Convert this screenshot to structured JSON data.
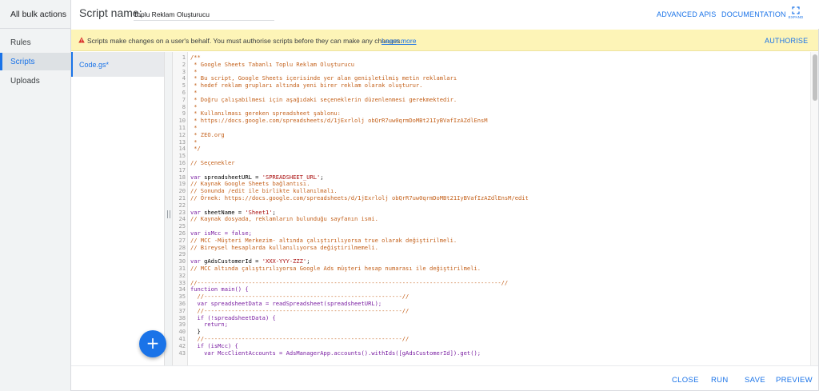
{
  "sidebar": {
    "all_bulk_actions": "All bulk actions",
    "items": [
      {
        "label": "Rules"
      },
      {
        "label": "Scripts"
      },
      {
        "label": "Uploads"
      }
    ]
  },
  "header": {
    "script_name_label": "Script name:",
    "script_name_value": "Toplu Reklam Oluşturucu",
    "advanced_apis": "ADVANCED APIS",
    "documentation": "DOCUMENTATION",
    "expand": "EXPAND"
  },
  "banner": {
    "text": "Scripts make changes on a user's behalf. You must authorise scripts before they can make any changes.",
    "learn_more": "Learn more",
    "authorise": "AUTHORISE"
  },
  "files": [
    {
      "label": "Code.gs*"
    }
  ],
  "editor": {
    "lines": [
      {
        "n": "1",
        "t": "/**"
      },
      {
        "n": "2",
        "t": " * Google Sheets Tabanlı Toplu Reklam Oluşturucu"
      },
      {
        "n": "3",
        "t": " *"
      },
      {
        "n": "4",
        "t": " * Bu script, Google Sheets içerisinde yer alan genişletilmiş metin reklamları"
      },
      {
        "n": "5",
        "t": " * hedef reklam grupları altında yeni birer reklam olarak oluşturur."
      },
      {
        "n": "6",
        "t": " *"
      },
      {
        "n": "7",
        "t": " * Doğru çalışabilmesi için aşağıdaki seçeneklerin düzenlenmesi gerekmektedir."
      },
      {
        "n": "8",
        "t": " *"
      },
      {
        "n": "9",
        "t": " * Kullanılması gereken spreadsheet şablonu:"
      },
      {
        "n": "10",
        "t": " * https://docs.google.com/spreadsheets/d/1jExrlolj obQrR7uw0qrmDoMBt21IyBVafIzAZdlEnsM"
      },
      {
        "n": "11",
        "t": " *"
      },
      {
        "n": "12",
        "t": " * ZEO.org"
      },
      {
        "n": "13",
        "t": " *"
      },
      {
        "n": "14",
        "t": " */"
      },
      {
        "n": "15",
        "t": ""
      },
      {
        "n": "16",
        "t": "// Seçenekler"
      },
      {
        "n": "17",
        "t": ""
      },
      {
        "n": "18",
        "t": "var spreadsheetURL = 'SPREADSHEET_URL';"
      },
      {
        "n": "19",
        "t": "// Kaynak Google Sheets bağlantısı."
      },
      {
        "n": "20",
        "t": "// Sonunda /edit ile birlikte kullanılmalı."
      },
      {
        "n": "21",
        "t": "// Örnek: https://docs.google.com/spreadsheets/d/1jExrlolj obQrR7uw0qrmDoMBt21IyBVafIzAZdlEnsM/edit"
      },
      {
        "n": "22",
        "t": ""
      },
      {
        "n": "23",
        "t": "var sheetName = 'Sheet1';"
      },
      {
        "n": "24",
        "t": "// Kaynak dosyada, reklamların bulunduğu sayfanın ismi."
      },
      {
        "n": "25",
        "t": ""
      },
      {
        "n": "26",
        "t": "var isMcc = false;"
      },
      {
        "n": "27",
        "t": "// MCC -Müşteri Merkezim- altında çalıştırılıyorsa true olarak değiştirilmeli."
      },
      {
        "n": "28",
        "t": "// Bireysel hesaplarda kullanılıyorsa değiştirilmemeli."
      },
      {
        "n": "29",
        "t": ""
      },
      {
        "n": "30",
        "t": "var gAdsCustomerId = 'XXX-YYY-ZZZ';"
      },
      {
        "n": "31",
        "t": "// MCC altında çalıştırılıyorsa Google Ads müşteri hesap numarası ile değiştirilmeli."
      },
      {
        "n": "32",
        "t": ""
      },
      {
        "n": "33",
        "t": "//-----------------------------------------------------------------------------------------//"
      },
      {
        "n": "34",
        "t": "function main() {"
      },
      {
        "n": "35",
        "t": "  //----------------------------------------------------------//"
      },
      {
        "n": "36",
        "t": "  var spreadsheetData = readSpreadsheet(spreadsheetURL);"
      },
      {
        "n": "37",
        "t": "  //----------------------------------------------------------//"
      },
      {
        "n": "38",
        "t": "  if (!spreadsheetData) {"
      },
      {
        "n": "39",
        "t": "    return;"
      },
      {
        "n": "40",
        "t": "  }"
      },
      {
        "n": "41",
        "t": "  //----------------------------------------------------------//"
      },
      {
        "n": "42",
        "t": "  if (isMcc) {"
      },
      {
        "n": "43",
        "t": "    var MccClientAccounts = AdsManagerApp.accounts().withIds([gAdsCustomerId]).get();"
      }
    ]
  },
  "footer": {
    "close": "CLOSE",
    "run": "RUN",
    "save": "SAVE",
    "preview": "PREVIEW"
  },
  "colors": {
    "accent": "#1a73e8",
    "banner_bg": "#fdf4b7",
    "warning": "#d93025",
    "comment": "#c4611b",
    "keyword": "#7a1fa2",
    "string": "#aa1111"
  }
}
